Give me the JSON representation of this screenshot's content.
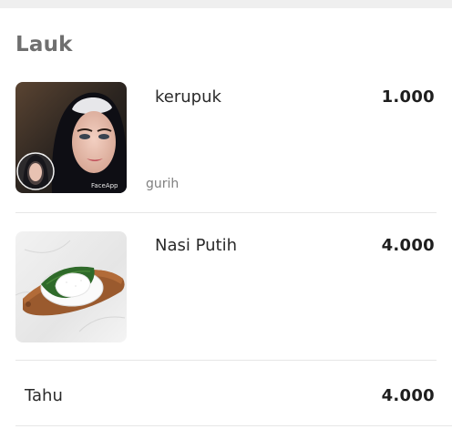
{
  "section": {
    "title": "Lauk"
  },
  "items": [
    {
      "name": "kerupuk",
      "price": "1.000",
      "description": "gurih",
      "image": "portrait-photo",
      "watermark": "FaceApp"
    },
    {
      "name": "Nasi Putih",
      "price": "4.000",
      "image": "rice-on-banana-leaf-photo"
    },
    {
      "name": "Tahu",
      "price": "4.000"
    }
  ],
  "colors": {
    "title": "#6f6f6f",
    "divider": "#e6e6e6",
    "description": "#808080"
  }
}
